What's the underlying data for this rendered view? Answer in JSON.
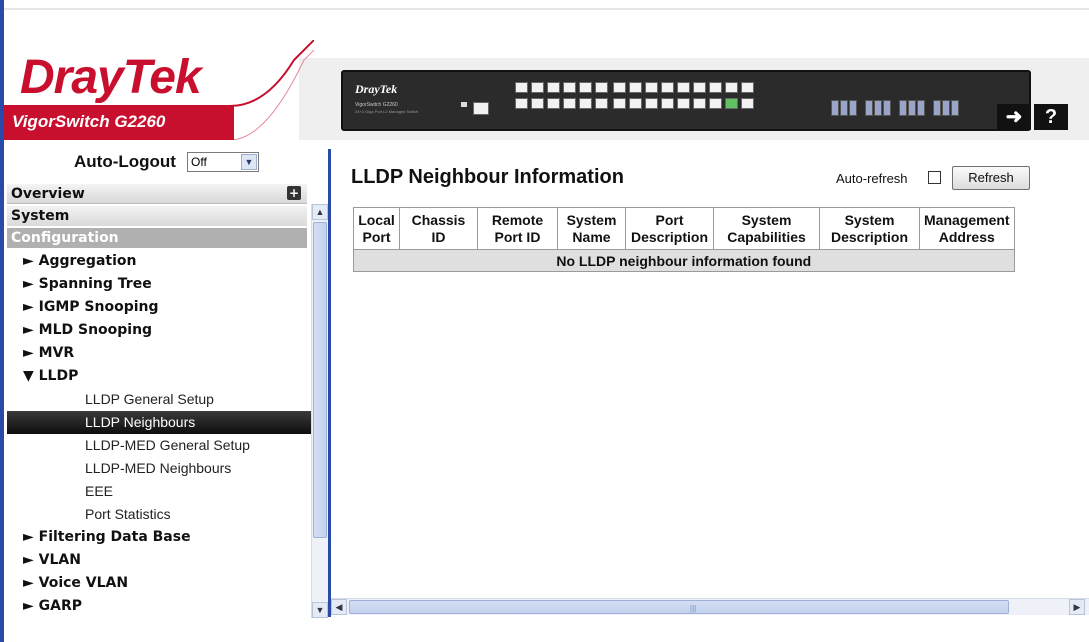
{
  "brand": {
    "logo": "DrayTek",
    "model": "VigorSwitch G2260"
  },
  "device": {
    "brand": "DrayTek",
    "model_line1": "VigorSwitch G2260",
    "model_line2": "24+2 Giga Port L2 Managed Switch"
  },
  "header_buttons": {
    "logout_icon": "logout-arrow-icon",
    "help_label": "?"
  },
  "sidebar": {
    "auto_logout_label": "Auto-Logout",
    "auto_logout_value": "Off",
    "overview": "Overview",
    "system": "System",
    "configuration": "Configuration",
    "items": [
      {
        "label": "► Aggregation",
        "level": 1
      },
      {
        "label": "► Spanning Tree",
        "level": 1
      },
      {
        "label": "► IGMP Snooping",
        "level": 1
      },
      {
        "label": "► MLD Snooping",
        "level": 1
      },
      {
        "label": "► MVR",
        "level": 1
      },
      {
        "label": "▼ LLDP",
        "level": 1
      },
      {
        "label": "LLDP General Setup",
        "level": 2
      },
      {
        "label": "LLDP Neighbours",
        "level": 2,
        "active": true
      },
      {
        "label": "LLDP-MED General Setup",
        "level": 2
      },
      {
        "label": "LLDP-MED Neighbours",
        "level": 2
      },
      {
        "label": "EEE",
        "level": 2
      },
      {
        "label": "Port Statistics",
        "level": 2
      },
      {
        "label": "► Filtering Data Base",
        "level": 1
      },
      {
        "label": "► VLAN",
        "level": 1
      },
      {
        "label": "► Voice VLAN",
        "level": 1
      },
      {
        "label": "► GARP",
        "level": 1
      }
    ]
  },
  "main": {
    "title": "LLDP Neighbour Information",
    "auto_refresh_label": "Auto-refresh",
    "auto_refresh_checked": false,
    "refresh_label": "Refresh",
    "table": {
      "columns": [
        {
          "line1": "Local",
          "line2": "Port"
        },
        {
          "line1": "Chassis",
          "line2": "ID"
        },
        {
          "line1": "Remote",
          "line2": "Port ID"
        },
        {
          "line1": "System",
          "line2": "Name"
        },
        {
          "line1": "Port",
          "line2": "Description"
        },
        {
          "line1": "System",
          "line2": "Capabilities"
        },
        {
          "line1": "System",
          "line2": "Description"
        },
        {
          "line1": "Management",
          "line2": "Address"
        }
      ],
      "empty_message": "No LLDP neighbour information found"
    }
  },
  "colors": {
    "brand_red": "#c8102e",
    "accent_blue": "#2a4aa8",
    "active_nav": "#0d0d0d"
  }
}
